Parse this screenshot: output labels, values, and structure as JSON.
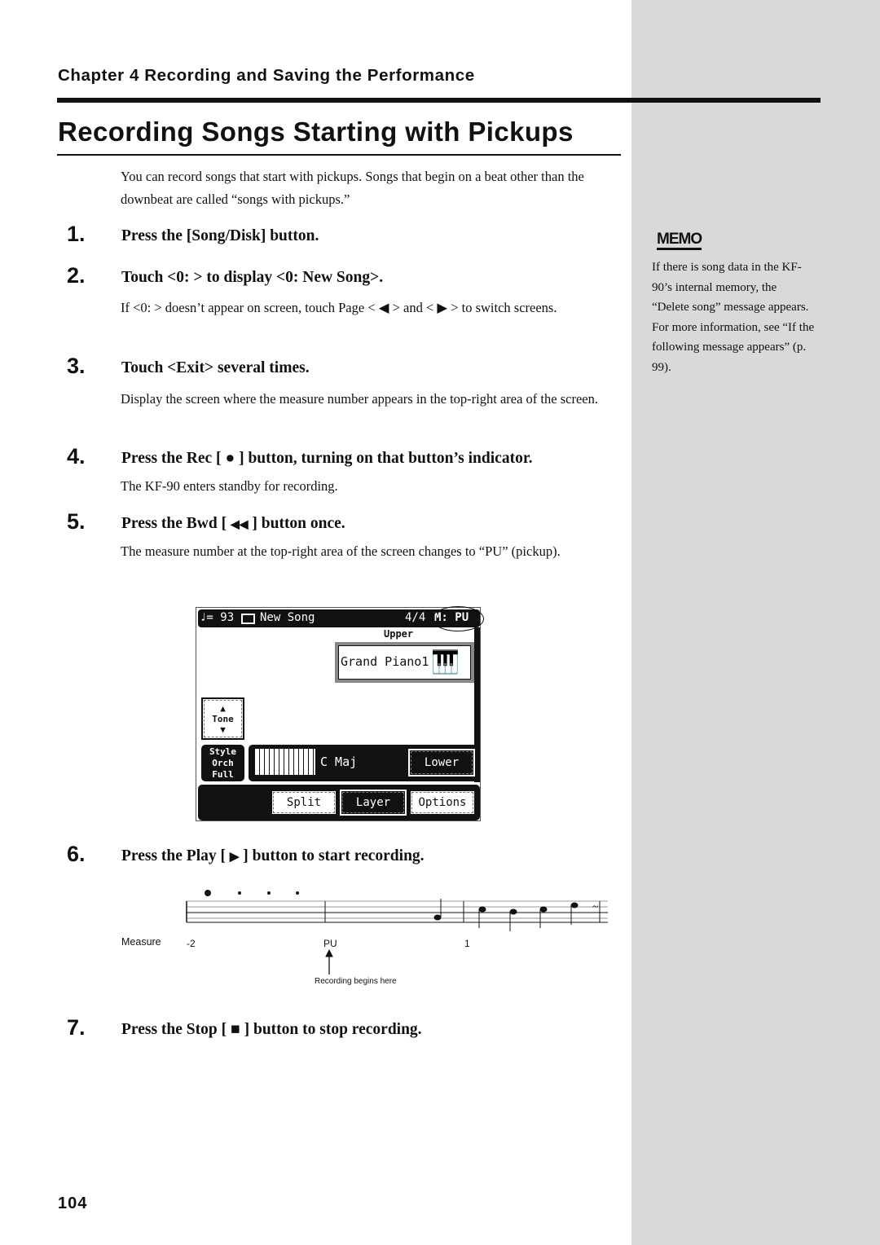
{
  "chapter": "Chapter 4 Recording and Saving the Performance",
  "title": "Recording Songs Starting with Pickups",
  "intro": "You can record songs that start with pickups. Songs that begin on a beat other than the downbeat are called “songs with pickups.”",
  "steps": [
    {
      "num": "1.",
      "heading": "Press the [Song/Disk] button."
    },
    {
      "num": "2.",
      "heading": "Touch <0: > to display <0: New Song>.",
      "body_a": "If <0: > doesn’t appear on screen, touch Page <",
      "body_b": "> and <",
      "body_c": "> to switch screens."
    },
    {
      "num": "3.",
      "heading": "Touch <Exit> several times.",
      "body": "Display the screen where the measure number appears in the top-right area of the screen."
    },
    {
      "num": "4.",
      "heading_a": "Press the Rec [",
      "heading_b": "] button, turning on that button’s indicator.",
      "body": "The KF-90 enters standby for recording."
    },
    {
      "num": "5.",
      "heading_a": "Press the Bwd [",
      "heading_b": "] button once.",
      "body": "The measure number at the top-right area of the screen changes to “PU” (pickup)."
    },
    {
      "num": "6.",
      "heading_a": "Press the Play [",
      "heading_b": "] button to start recording."
    },
    {
      "num": "7.",
      "heading_a": "Press the Stop [",
      "heading_b": "] button to stop recording."
    }
  ],
  "lcd": {
    "tempo": "♩= 93",
    "song": "New Song",
    "time_sig": "4/4",
    "measure": "M: PU",
    "upper_label": "Upper",
    "tone_name": "Grand Piano1",
    "tone_btn": "Tone",
    "style_lines": [
      "Style",
      "Orch",
      "Full"
    ],
    "chord": "C Maj",
    "lower": "Lower",
    "split": "Split",
    "layer": "Layer",
    "options": "Options"
  },
  "notation": {
    "measure_label": "Measure",
    "m1": "-2",
    "m2": "PU",
    "m3": "1",
    "arrow_caption": "Recording begins here"
  },
  "memo": {
    "icon": "MEMO",
    "text": "If there is song data in the KF-90’s internal memory, the “Delete song” message appears. For more information, see “If the following message appears” (p. 99)."
  },
  "page_number": "104"
}
